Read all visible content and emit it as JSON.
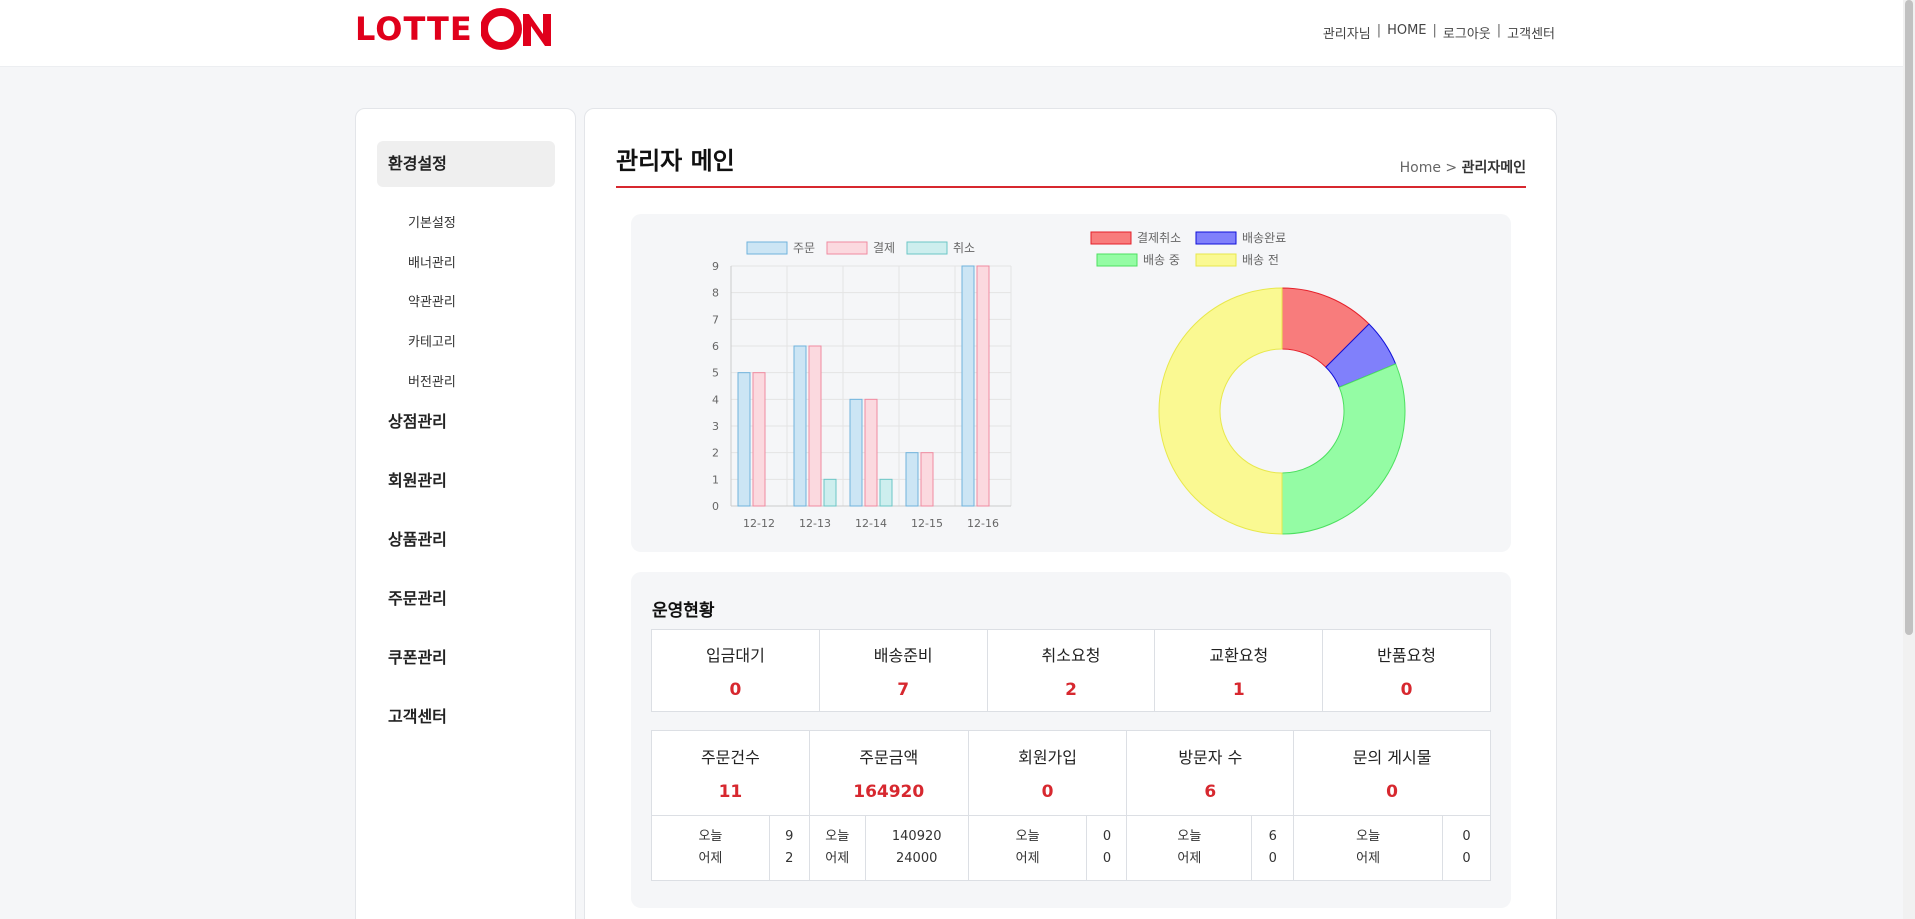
{
  "header": {
    "logo_text": "LOTTE",
    "logo_on": "ON",
    "links": [
      "관리자님",
      "HOME",
      "로그아웃",
      "고객센터"
    ]
  },
  "sidebar": {
    "groups": [
      {
        "label": "환경설정",
        "active": true,
        "items": [
          "기본설정",
          "배너관리",
          "약관관리",
          "카테고리",
          "버전관리"
        ]
      },
      {
        "label": "상점관리"
      },
      {
        "label": "회원관리"
      },
      {
        "label": "상품관리"
      },
      {
        "label": "주문관리"
      },
      {
        "label": "쿠폰관리"
      },
      {
        "label": "고객센터"
      }
    ]
  },
  "main": {
    "title": "관리자 메인",
    "breadcrumb_home": "Home",
    "breadcrumb_sep": ">",
    "breadcrumb_current": "관리자메인"
  },
  "chart_data": [
    {
      "type": "bar",
      "categories": [
        "12-12",
        "12-13",
        "12-14",
        "12-15",
        "12-16"
      ],
      "series": [
        {
          "name": "주문",
          "values": [
            5,
            6,
            4,
            2,
            9
          ],
          "fill": "#cce5f4",
          "stroke": "#6fb3dd"
        },
        {
          "name": "결제",
          "values": [
            5,
            6,
            4,
            2,
            9
          ],
          "fill": "#fbd9df",
          "stroke": "#f08aa0"
        },
        {
          "name": "취소",
          "values": [
            0,
            1,
            1,
            0,
            0
          ],
          "fill": "#cdeeee",
          "stroke": "#6cc6c6"
        }
      ],
      "ylim": [
        0,
        9
      ],
      "yticks": [
        0,
        1,
        2,
        3,
        4,
        5,
        6,
        7,
        8,
        9
      ],
      "grid": true,
      "legend": "top"
    },
    {
      "type": "pie",
      "donut": true,
      "slices": [
        {
          "name": "결제취소",
          "value": 2,
          "fill": "#f87c7c",
          "stroke": "#e5202a"
        },
        {
          "name": "배송완료",
          "value": 1,
          "fill": "#8080fb",
          "stroke": "#1010d8"
        },
        {
          "name": "배송 중",
          "value": 5,
          "fill": "#94fca4",
          "stroke": "#4de060"
        },
        {
          "name": "배송 전",
          "value": 8,
          "fill": "#faf992",
          "stroke": "#e8e84c"
        }
      ],
      "legend": "top"
    }
  ],
  "ops": {
    "title": "운영현황",
    "row1": [
      {
        "label": "입금대기",
        "value": "0"
      },
      {
        "label": "배송준비",
        "value": "7"
      },
      {
        "label": "취소요청",
        "value": "2"
      },
      {
        "label": "교환요청",
        "value": "1"
      },
      {
        "label": "반품요청",
        "value": "0"
      }
    ],
    "row2": [
      {
        "label": "주문건수",
        "value": "11",
        "today": "9",
        "yesterday": "2"
      },
      {
        "label": "주문금액",
        "value": "164920",
        "today": "140920",
        "yesterday": "24000"
      },
      {
        "label": "회원가입",
        "value": "0",
        "today": "0",
        "yesterday": "0"
      },
      {
        "label": "방문자 수",
        "value": "6",
        "today": "6",
        "yesterday": "0"
      },
      {
        "label": "문의 게시물",
        "value": "0",
        "today": "0",
        "yesterday": "0"
      }
    ],
    "today_label": "오늘",
    "yesterday_label": "어제"
  },
  "colors": {
    "accent": "#d7282f",
    "brand": "#e0001b"
  }
}
